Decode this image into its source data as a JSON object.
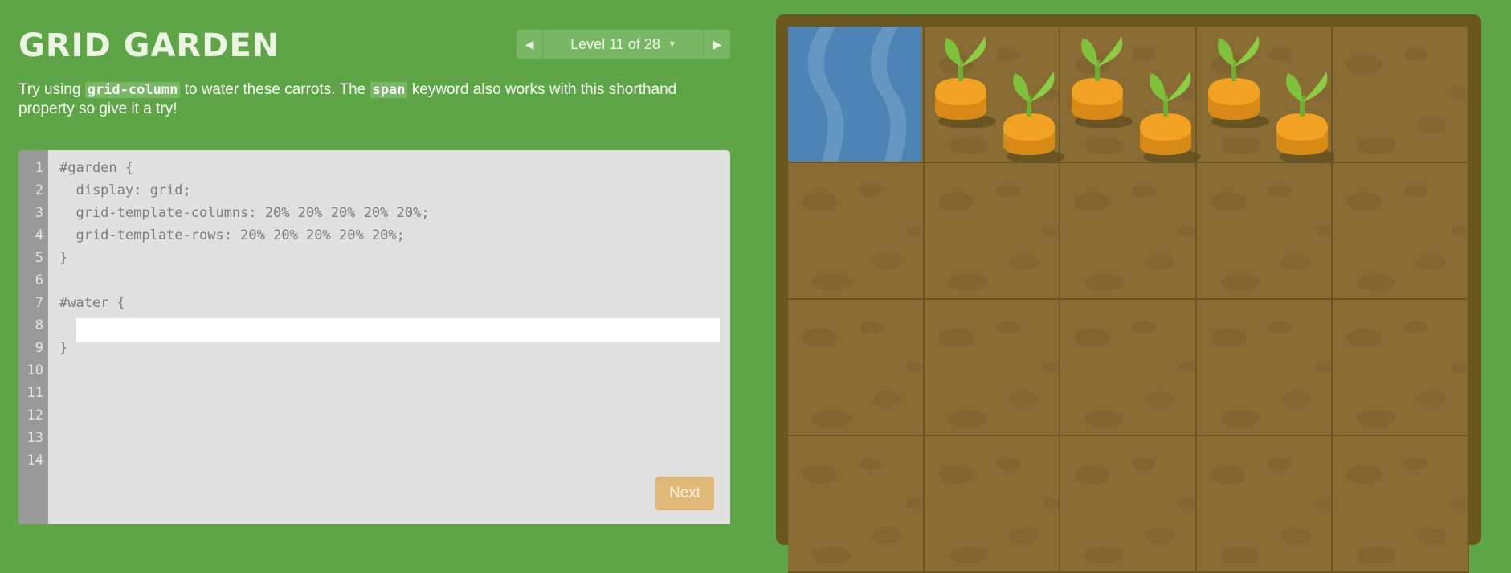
{
  "header": {
    "title": "GRID GARDEN",
    "level_label": "Level 11 of 28",
    "prev_symbol": "◀",
    "next_symbol": "▶",
    "caret_symbol": "▼"
  },
  "instructions": {
    "part1": "Try using ",
    "code1": "grid-column",
    "part2": " to water these carrots. The ",
    "code2": "span",
    "part3": " keyword also works with this shorthand property so give it a try!"
  },
  "editor": {
    "line_numbers": [
      "1",
      "2",
      "3",
      "4",
      "5",
      "6",
      "7",
      "8",
      "9",
      "10",
      "11",
      "12",
      "13",
      "14"
    ],
    "lines": [
      "#garden {",
      "  display: grid;",
      "  grid-template-columns: 20% 20% 20% 20% 20%;",
      "  grid-template-rows: 20% 20% 20% 20% 20%;",
      "}",
      "",
      "#water {",
      "",
      "}"
    ],
    "input_value": "",
    "next_label": "Next"
  },
  "garden": {
    "rows_visible": 4,
    "columns": 5,
    "water_cell": {
      "row": 1,
      "column": 1
    },
    "carrots_row": 1,
    "carrots_columns": [
      2,
      3,
      4
    ],
    "colors": {
      "background": "#5ea548",
      "soil": "#886c34",
      "border": "#6b561e",
      "water": "#4b84b5",
      "carrot": "#f2a223",
      "leaf": "#7fc13a"
    }
  }
}
